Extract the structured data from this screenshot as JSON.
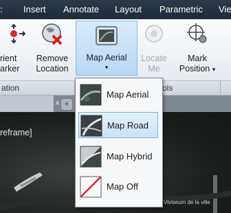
{
  "menubar": {
    "items": [
      "Insert",
      "Annotate",
      "Layout",
      "Parametric",
      "Vie"
    ]
  },
  "ribbon": {
    "buttons": [
      {
        "line1": "rient",
        "line2": "arker"
      },
      {
        "line1": "Remove",
        "line2": "Location"
      },
      {
        "line1": "Map Aerial",
        "caret": "▾"
      },
      {
        "line1": "Locate",
        "line2": "Me"
      },
      {
        "line1": "Mark",
        "line2": "Position",
        "caret": "▾"
      }
    ],
    "panels": [
      "ation",
      "ols"
    ]
  },
  "tabstrip": {
    "close_glyph": "×",
    "new_tab_glyph": "+"
  },
  "viewport": {
    "label": "reframe]",
    "watermark": "Viviseum de la ville"
  },
  "dropdown": {
    "items": [
      {
        "label": "Map Aerial",
        "icon": "map-aerial-icon"
      },
      {
        "label": "Map Road",
        "icon": "map-road-icon",
        "selected": true
      },
      {
        "label": "Map Hybrid",
        "icon": "map-hybrid-icon"
      },
      {
        "label": "Map Off",
        "icon": "map-off-icon"
      }
    ]
  },
  "colors": {
    "menubar": "#2d3a4d",
    "ribbon_active": "#b8d8f3",
    "dropdown_selected": "#c9e2f8",
    "map_off_slash": "#d22a2a"
  }
}
